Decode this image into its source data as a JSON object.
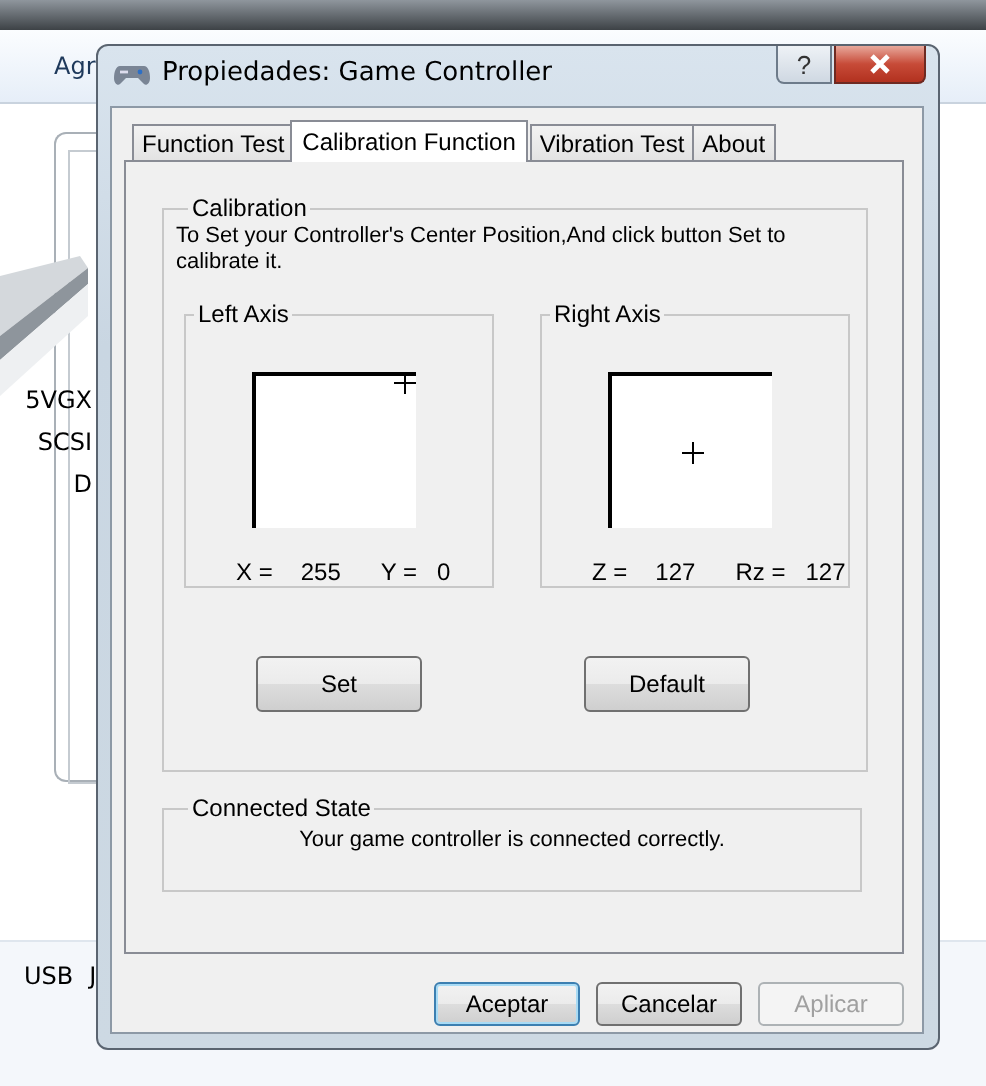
{
  "background": {
    "toolbar_item": "Agr",
    "device_labels": [
      "5VGX",
      "SCSI",
      "D"
    ],
    "footer_labels": [
      "USB",
      "J"
    ]
  },
  "window": {
    "title": "Propiedades: Game Controller",
    "help": "?"
  },
  "tabs": [
    {
      "label": "Function Test",
      "selected": false
    },
    {
      "label": "Calibration Function",
      "selected": true
    },
    {
      "label": "Vibration Test",
      "selected": false
    },
    {
      "label": "About",
      "selected": false
    }
  ],
  "calibration": {
    "title": "Calibration",
    "instructions": "To Set your Controller's  Center Position,And click button Set to calibrate it.",
    "axes": [
      {
        "title": "Left Axis",
        "readings": [
          {
            "label": "X =",
            "value": "255"
          },
          {
            "label": "Y =",
            "value": "0"
          }
        ],
        "button": "Set"
      },
      {
        "title": "Right Axis",
        "readings": [
          {
            "label": "Z =",
            "value": "127"
          },
          {
            "label": "Rz =",
            "value": "127"
          }
        ],
        "button": "Default"
      }
    ]
  },
  "connected_state": {
    "title": "Connected State",
    "message": "Your game controller is connected correctly."
  },
  "buttons": [
    {
      "label": "Aceptar",
      "default": true,
      "disabled": false
    },
    {
      "label": "Cancelar",
      "default": false,
      "disabled": false
    },
    {
      "label": "Aplicar",
      "default": false,
      "disabled": true
    }
  ]
}
